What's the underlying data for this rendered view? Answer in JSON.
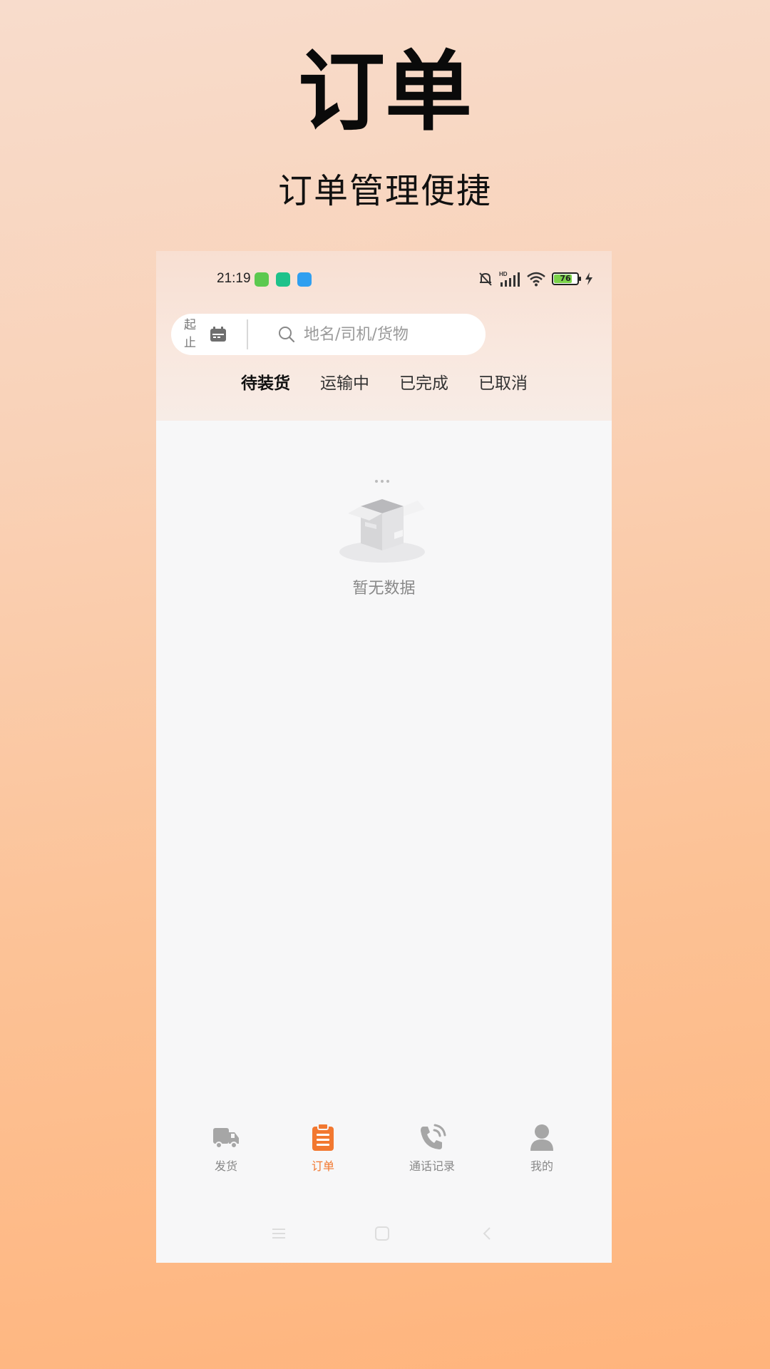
{
  "promo": {
    "title": "订单",
    "subtitle": "订单管理便捷"
  },
  "status_bar": {
    "time": "21:19",
    "app_icons": [
      "green-app-icon",
      "teal-shield-app-icon",
      "blue-app-icon"
    ],
    "hd_label": "HD",
    "battery": "76",
    "battery_level": 0.76
  },
  "search": {
    "date_range_label_start": "起",
    "date_range_label_end": "止",
    "placeholder": "地名/司机/货物"
  },
  "tabs": [
    {
      "label": "待装货",
      "active": true
    },
    {
      "label": "运输中",
      "active": false
    },
    {
      "label": "已完成",
      "active": false
    },
    {
      "label": "已取消",
      "active": false
    }
  ],
  "empty_state": {
    "text": "暂无数据"
  },
  "bottom_nav": [
    {
      "label": "发货",
      "icon": "truck-icon",
      "active": false
    },
    {
      "label": "订单",
      "icon": "clipboard-icon",
      "active": true
    },
    {
      "label": "通话记录",
      "icon": "phone-icon",
      "active": false
    },
    {
      "label": "我的",
      "icon": "person-icon",
      "active": false
    }
  ],
  "colors": {
    "accent": "#f27830",
    "inactive": "#a6a6a6"
  }
}
